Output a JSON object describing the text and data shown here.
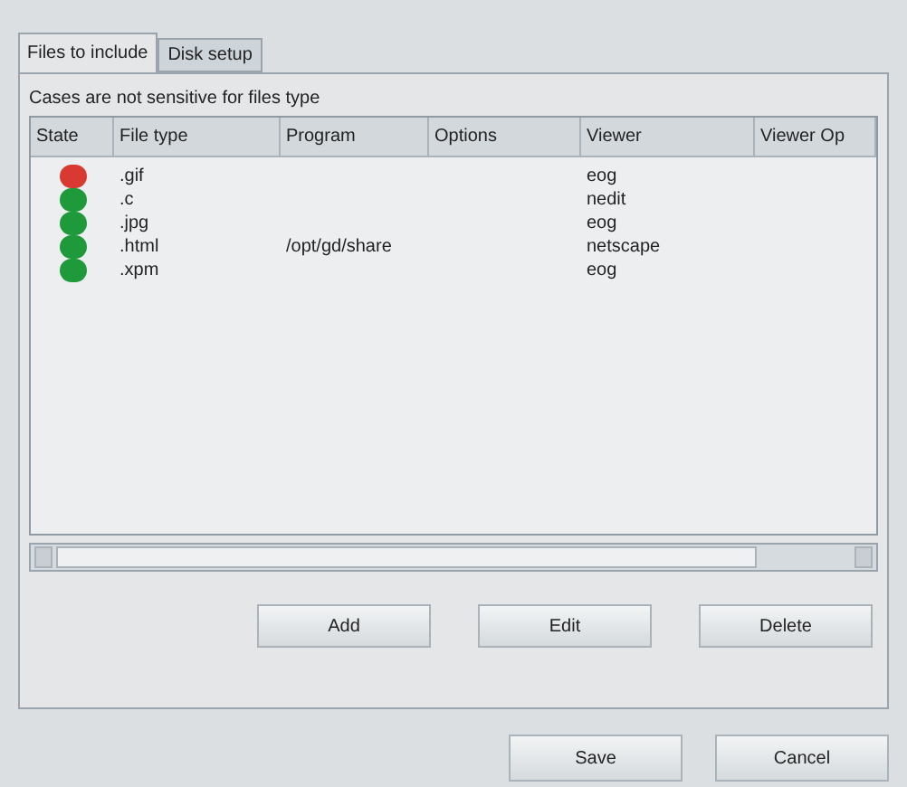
{
  "tabs": [
    {
      "label": "Files to include",
      "selected": true
    },
    {
      "label": "Disk setup",
      "selected": false
    }
  ],
  "note": "Cases are not sensitive for files type",
  "table": {
    "columns": [
      "State",
      "File type",
      "Program",
      "Options",
      "Viewer",
      "Viewer Op"
    ],
    "rows": [
      {
        "color": "#d83a32",
        "file_type": ".gif",
        "program": "",
        "options": "",
        "viewer": "eog"
      },
      {
        "color": "#1f9a3a",
        "file_type": ".c",
        "program": "",
        "options": "",
        "viewer": "nedit"
      },
      {
        "color": "#1f9a3a",
        "file_type": ".jpg",
        "program": "",
        "options": "",
        "viewer": "eog"
      },
      {
        "color": "#1f9a3a",
        "file_type": ".html",
        "program": "/opt/gd/share",
        "options": "",
        "viewer": "netscape"
      },
      {
        "color": "#1f9a3a",
        "file_type": ".xpm",
        "program": "",
        "options": "",
        "viewer": "eog"
      }
    ]
  },
  "panel_buttons": [
    "Add",
    "Edit",
    "Delete"
  ],
  "dialog_buttons": [
    "Save",
    "Cancel"
  ]
}
